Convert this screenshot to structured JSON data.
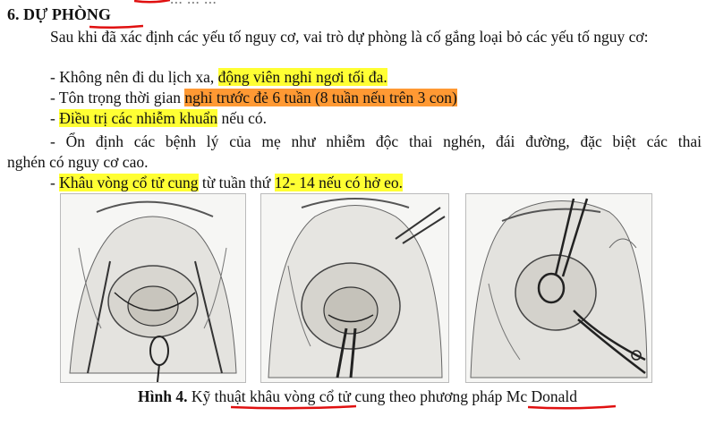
{
  "top_remnant": "... ... ...",
  "heading": "6. DỰ PHÒNG",
  "intro": "Sau khi đã xác định các yếu tố nguy cơ, vai trò dự phòng là cố gắng loại bỏ các yếu tố nguy cơ:",
  "bullets": {
    "b1_plain": "- Không nên đi du lịch xa, ",
    "b1_highlight": "động viên nghỉ ngơi tối đa.",
    "b2_plain": "- Tôn trọng thời gian ",
    "b2_highlight": "nghỉ trước đẻ 6 tuần (8 tuần nếu trên 3 con)",
    "b3_dash": "- ",
    "b3_highlight": "Điều trị các nhiễm khuẩn",
    "b3_plain": " nếu có.",
    "b4_line1": "- Ổn định các bệnh lý của mẹ như nhiễm độc thai nghén, đái đường, đặc biệt các thai",
    "b4_line2": "nghén có nguy cơ cao.",
    "b5_dash": "- ",
    "b5_highlight1": "Khâu vòng cổ tử cung",
    "b5_plain": " từ tuần thứ ",
    "b5_highlight2": "12- 14 nếu có hở eo."
  },
  "caption": {
    "label": "Hình 4.",
    "text": " Kỹ thuật khâu vòng cổ tử cung theo phương pháp Mc Donald"
  },
  "colors": {
    "highlight_yellow": "#ffff33",
    "highlight_orange": "#ff9933",
    "pen_red": "#e01010"
  },
  "figures": [
    "surgical-illustration",
    "surgical-illustration",
    "surgical-illustration"
  ]
}
